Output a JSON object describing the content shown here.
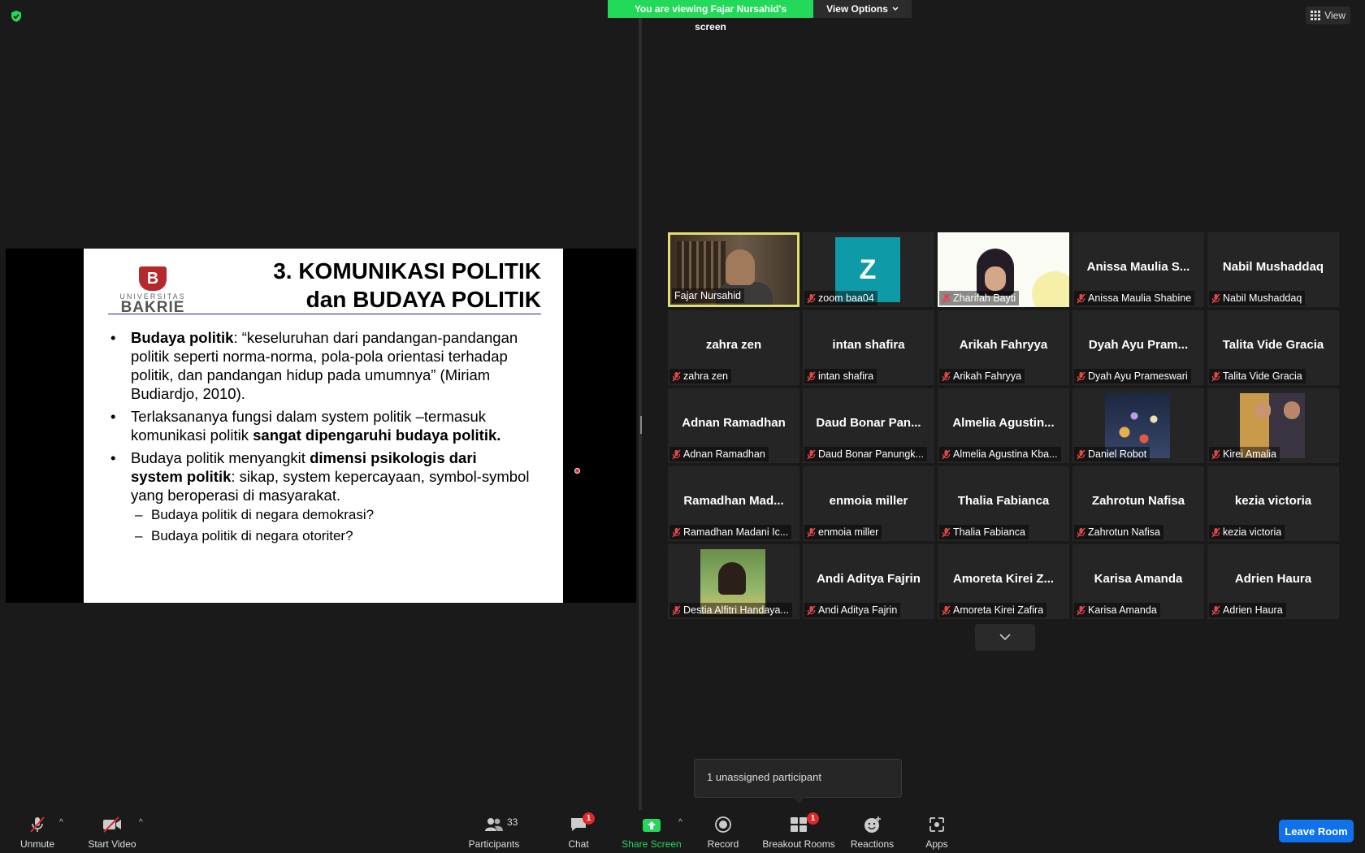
{
  "banner": {
    "viewing_text": "You are viewing Fajar Nursahid's screen",
    "view_options_label": "View Options"
  },
  "top_right": {
    "view_label": "View"
  },
  "slide": {
    "logo_top": "UNIVERSITAS",
    "logo_bottom": "BAKRIE",
    "title_line1": "3. KOMUNIKASI POLITIK",
    "title_line2": "dan BUDAYA POLITIK",
    "b1_bold": "Budaya politik",
    "b1_rest": ": “keseluruhan dari pandangan-pandangan politik seperti norma-norma, pola-pola orientasi terhadap politik, dan pandangan hidup pada umumnya” (Miriam Budiardjo, 2010).",
    "b2_text": "Terlaksananya fungsi dalam system politik –termasuk komunikasi politik ",
    "b2_bold": "sangat dipengaruhi budaya politik.",
    "b3_text": "Budaya politik menyangkit ",
    "b3_bold": "dimensi psikologis dari system politik",
    "b3_rest": ": sikap, system kepercayaan, symbol-symbol yang beroperasi di masyarakat.",
    "sub1": "Budaya politik  di negara demokrasi?",
    "sub2": "Budaya politik  di negara otoriter?"
  },
  "participants": [
    {
      "display": "",
      "label": "Fajar Nursahid",
      "muted": false,
      "kind": "video-fajar",
      "active": true
    },
    {
      "display": "Z",
      "label": "zoom baa04",
      "muted": true,
      "kind": "avatar-z"
    },
    {
      "display": "",
      "label": "Zharifah Bayti",
      "muted": true,
      "kind": "video-zh"
    },
    {
      "display": "Anissa  Maulia  S...",
      "label": "Anissa Maulia Shabine",
      "muted": true,
      "kind": "name"
    },
    {
      "display": "Nabil Mushaddaq",
      "label": "Nabil Mushaddaq",
      "muted": true,
      "kind": "name"
    },
    {
      "display": "zahra zen",
      "label": "zahra zen",
      "muted": true,
      "kind": "name"
    },
    {
      "display": "intan shafira",
      "label": "intan shafira",
      "muted": true,
      "kind": "name"
    },
    {
      "display": "Arikah Fahryya",
      "label": "Arikah Fahryya",
      "muted": true,
      "kind": "name"
    },
    {
      "display": "Dyah  Ayu  Pram...",
      "label": "Dyah Ayu Prameswari",
      "muted": true,
      "kind": "name"
    },
    {
      "display": "Talita Vide Gracia",
      "label": "Talita Vide Gracia",
      "muted": true,
      "kind": "name"
    },
    {
      "display": "Adnan Ramadhan",
      "label": "Adnan Ramadhan",
      "muted": true,
      "kind": "name"
    },
    {
      "display": "Daud  Bonar  Pan...",
      "label": "Daud Bonar Panungk...",
      "muted": true,
      "kind": "name"
    },
    {
      "display": "Almelia  Agustin...",
      "label": "Almelia Agustina Kba...",
      "muted": true,
      "kind": "name"
    },
    {
      "display": "",
      "label": "Daniel Robot",
      "muted": true,
      "kind": "img-daniel"
    },
    {
      "display": "",
      "label": "Kirei Amalia",
      "muted": true,
      "kind": "img-kirei"
    },
    {
      "display": "Ramadhan  Mad...",
      "label": "Ramadhan Madani Ic...",
      "muted": true,
      "kind": "name"
    },
    {
      "display": "enmoia miller",
      "label": "enmoia miller",
      "muted": true,
      "kind": "name"
    },
    {
      "display": "Thalia Fabianca",
      "label": "Thalia Fabianca",
      "muted": true,
      "kind": "name"
    },
    {
      "display": "Zahrotun Nafisa",
      "label": "Zahrotun Nafisa",
      "muted": true,
      "kind": "name"
    },
    {
      "display": "kezia victoria",
      "label": "kezia victoria",
      "muted": true,
      "kind": "name"
    },
    {
      "display": "",
      "label": "Destia Alfitri Handaya...",
      "muted": true,
      "kind": "img-destia"
    },
    {
      "display": "Andi Aditya Fajrin",
      "label": "Andi Aditya Fajrin",
      "muted": true,
      "kind": "name"
    },
    {
      "display": "Amoreta  Kirei  Z...",
      "label": "Amoreta Kirei Zafira",
      "muted": true,
      "kind": "name"
    },
    {
      "display": "Karisa Amanda",
      "label": "Karisa Amanda",
      "muted": true,
      "kind": "name"
    },
    {
      "display": "Adrien Haura",
      "label": "Adrien Haura",
      "muted": true,
      "kind": "name"
    }
  ],
  "tooltip": {
    "text": "1 unassigned participant"
  },
  "toolbar": {
    "unmute": "Unmute",
    "start_video": "Start Video",
    "participants": "Participants",
    "participants_count": "33",
    "chat": "Chat",
    "chat_badge": "1",
    "share_screen": "Share Screen",
    "record": "Record",
    "breakout": "Breakout Rooms",
    "breakout_badge": "1",
    "reactions": "Reactions",
    "apps": "Apps",
    "leave": "Leave Room"
  },
  "colors": {
    "accent_green": "#23d959",
    "leave_blue": "#0e72ed",
    "badge_red": "#e02828",
    "active_border": "#e0e070"
  }
}
